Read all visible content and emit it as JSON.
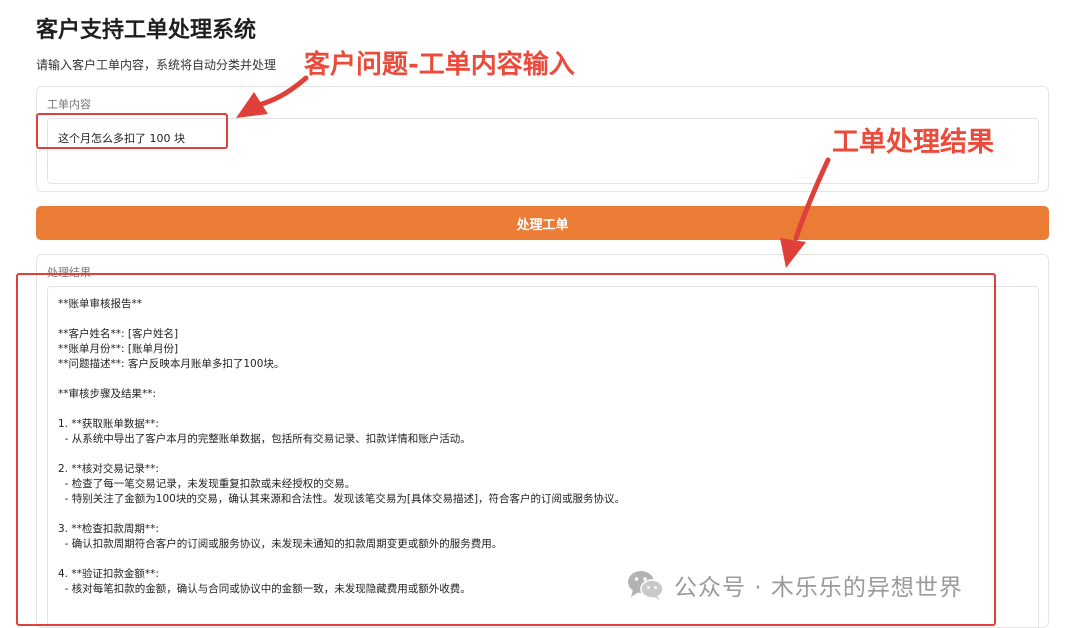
{
  "header": {
    "title": "客户支持工单处理系统",
    "subtitle": "请输入客户工单内容，系统将自动分类并处理"
  },
  "input": {
    "label": "工单内容",
    "value": "这个月怎么多扣了 100 块"
  },
  "submit_label": "处理工单",
  "output": {
    "label": "处理结果",
    "lines": [
      "**账单审核报告**",
      "",
      "**客户姓名**: [客户姓名]",
      "**账单月份**: [账单月份]",
      "**问题描述**: 客户反映本月账单多扣了100块。",
      "",
      "**审核步骤及结果**:",
      "",
      "1. **获取账单数据**:",
      "  - 从系统中导出了客户本月的完整账单数据，包括所有交易记录、扣款详情和账户活动。",
      "",
      "2. **核对交易记录**:",
      "  - 检查了每一笔交易记录，未发现重复扣款或未经授权的交易。",
      "  - 特别关注了金额为100块的交易，确认其来源和合法性。发现该笔交易为[具体交易描述]，符合客户的订阅或服务协议。",
      "",
      "3. **检查扣款周期**:",
      "  - 确认扣款周期符合客户的订阅或服务协议，未发现未通知的扣款周期变更或额外的服务费用。",
      "",
      "4. **验证扣款金额**:",
      "  - 核对每笔扣款的金额，确认与合同或协议中的金额一致，未发现隐藏费用或额外收费。"
    ]
  },
  "annotations": {
    "input_note": "客户问题-工单内容输入",
    "output_note": "工单处理结果",
    "color": "#e0403a"
  },
  "watermark": {
    "icon": "wechat-icon",
    "text": "公众号 · 木乐乐的异想世界"
  }
}
